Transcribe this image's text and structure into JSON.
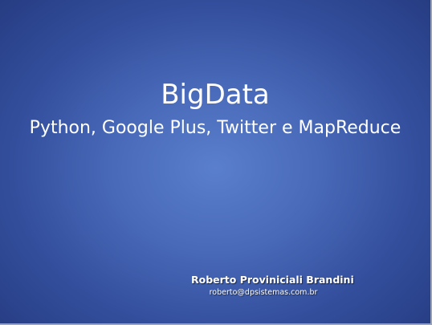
{
  "slide": {
    "title": "BigData",
    "subtitle": "Python, Google Plus, Twitter e MapReduce",
    "author": "Roberto Proviniciali Brandini",
    "email": "roberto@dpsistemas.com.br"
  },
  "colors": {
    "background_center": "#5a7fcc",
    "background_edge": "#263c82",
    "text": "#ffffff"
  }
}
